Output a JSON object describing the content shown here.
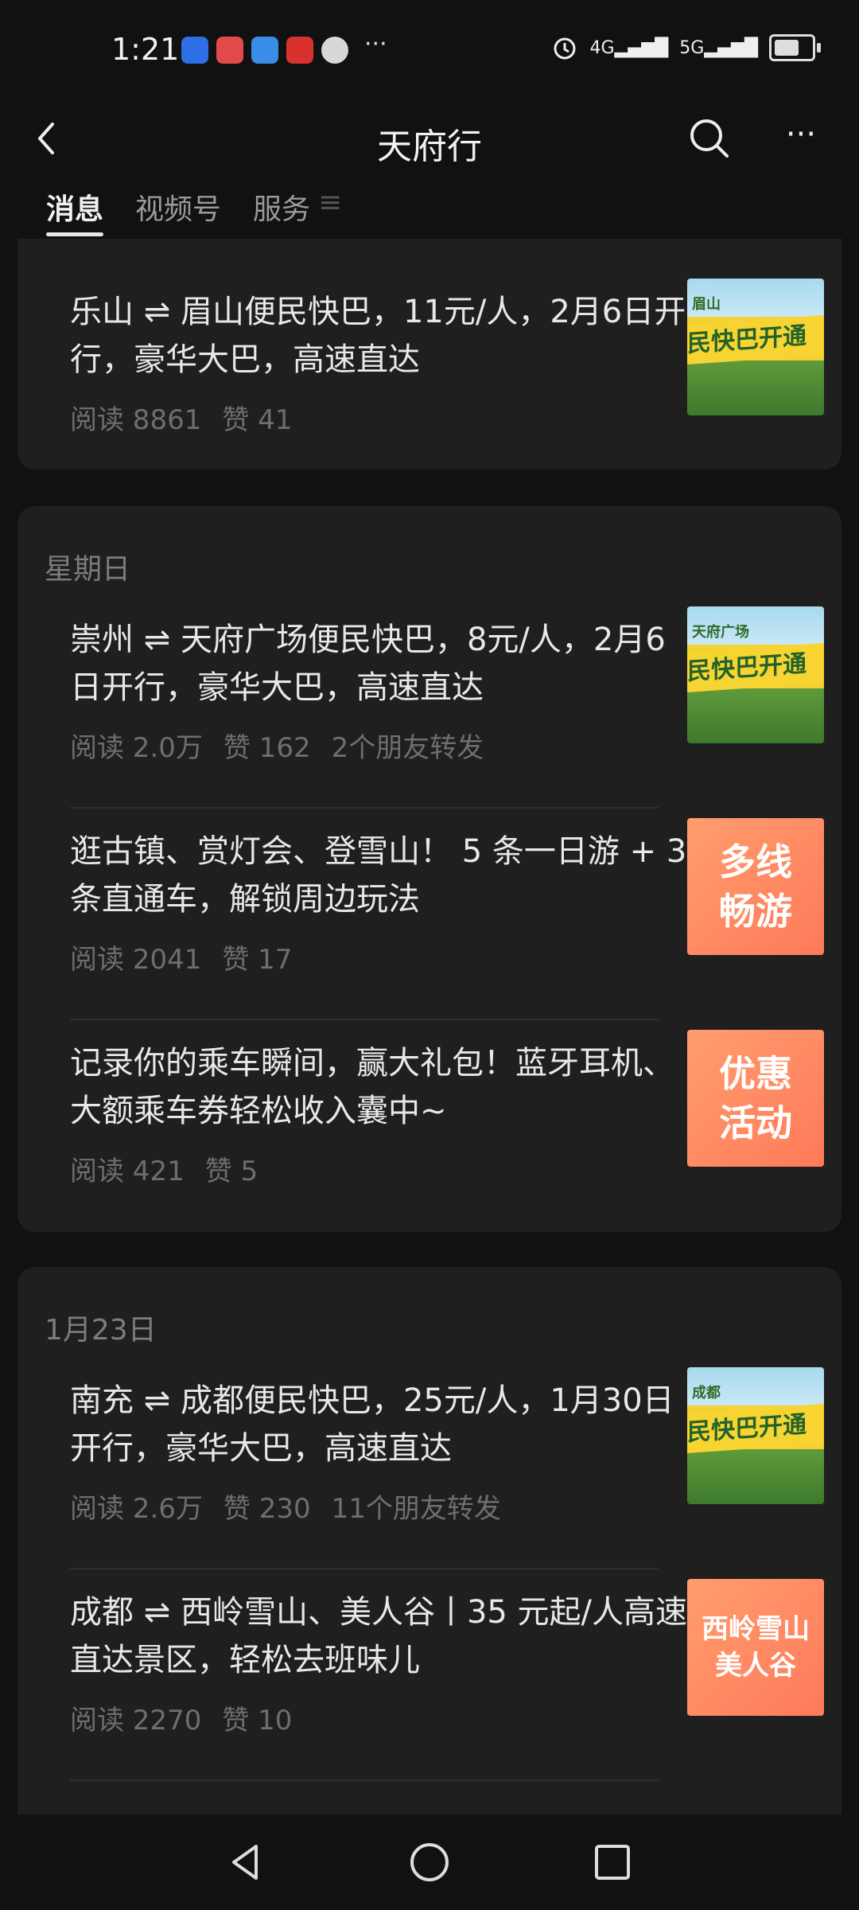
{
  "status": {
    "time": "1:21",
    "dots": "···",
    "net1": "4G",
    "net2": "5G"
  },
  "header": {
    "title": "天府行"
  },
  "tabs": [
    {
      "label": "消息"
    },
    {
      "label": "视频号"
    },
    {
      "label": "服务"
    },
    {
      "label": "≡"
    }
  ],
  "sections": [
    {
      "date": "",
      "articles": [
        {
          "title": "乐山 ⇌ 眉山便民快巴，11元/人，2月6日开行，豪华大巴，高速直达",
          "reads": "阅读 8861",
          "likes": "赞 41",
          "shares": "",
          "thumb_city": "眉山",
          "thumb_text": "民快巴开通"
        }
      ]
    },
    {
      "date": "星期日",
      "articles": [
        {
          "title": "崇州 ⇌ 天府广场便民快巴，8元/人，2月6日开行，豪华大巴，高速直达",
          "reads": "阅读 2.0万",
          "likes": "赞 162",
          "shares": "2个朋友转发",
          "thumb_city": "天府广场",
          "thumb_text": "民快巴开通"
        },
        {
          "title": "逛古镇、赏灯会、登雪山！ 5 条一日游 + 3 条直通车，解锁周边玩法",
          "reads": "阅读 2041",
          "likes": "赞 17",
          "shares": "",
          "thumb_text1": "多线",
          "thumb_text2": "畅游"
        },
        {
          "title": "记录你的乘车瞬间，赢大礼包！蓝牙耳机、大额乘车券轻松收入囊中~",
          "reads": "阅读 421",
          "likes": "赞 5",
          "shares": "",
          "thumb_text1": "优惠",
          "thumb_text2": "活动"
        }
      ]
    },
    {
      "date": "1月23日",
      "articles": [
        {
          "title": "南充 ⇌ 成都便民快巴，25元/人，1月30日开行，豪华大巴，高速直达",
          "reads": "阅读 2.6万",
          "likes": "赞 230",
          "shares": "11个朋友转发",
          "thumb_city": "成都",
          "thumb_text": "民快巴开通"
        },
        {
          "title": "成都 ⇌ 西岭雪山、美人谷丨35 元起/人高速直达景区，轻松去班味儿",
          "reads": "阅读 2270",
          "likes": "赞 10",
          "shares": "",
          "thumb_text1": "西岭雪山",
          "thumb_text2": "美人谷"
        }
      ]
    }
  ],
  "colors": {
    "background": "#111111",
    "card": "#1f1f1f",
    "thumb_orange": "#ff8a62",
    "thumb_yellow": "#f5d233"
  }
}
